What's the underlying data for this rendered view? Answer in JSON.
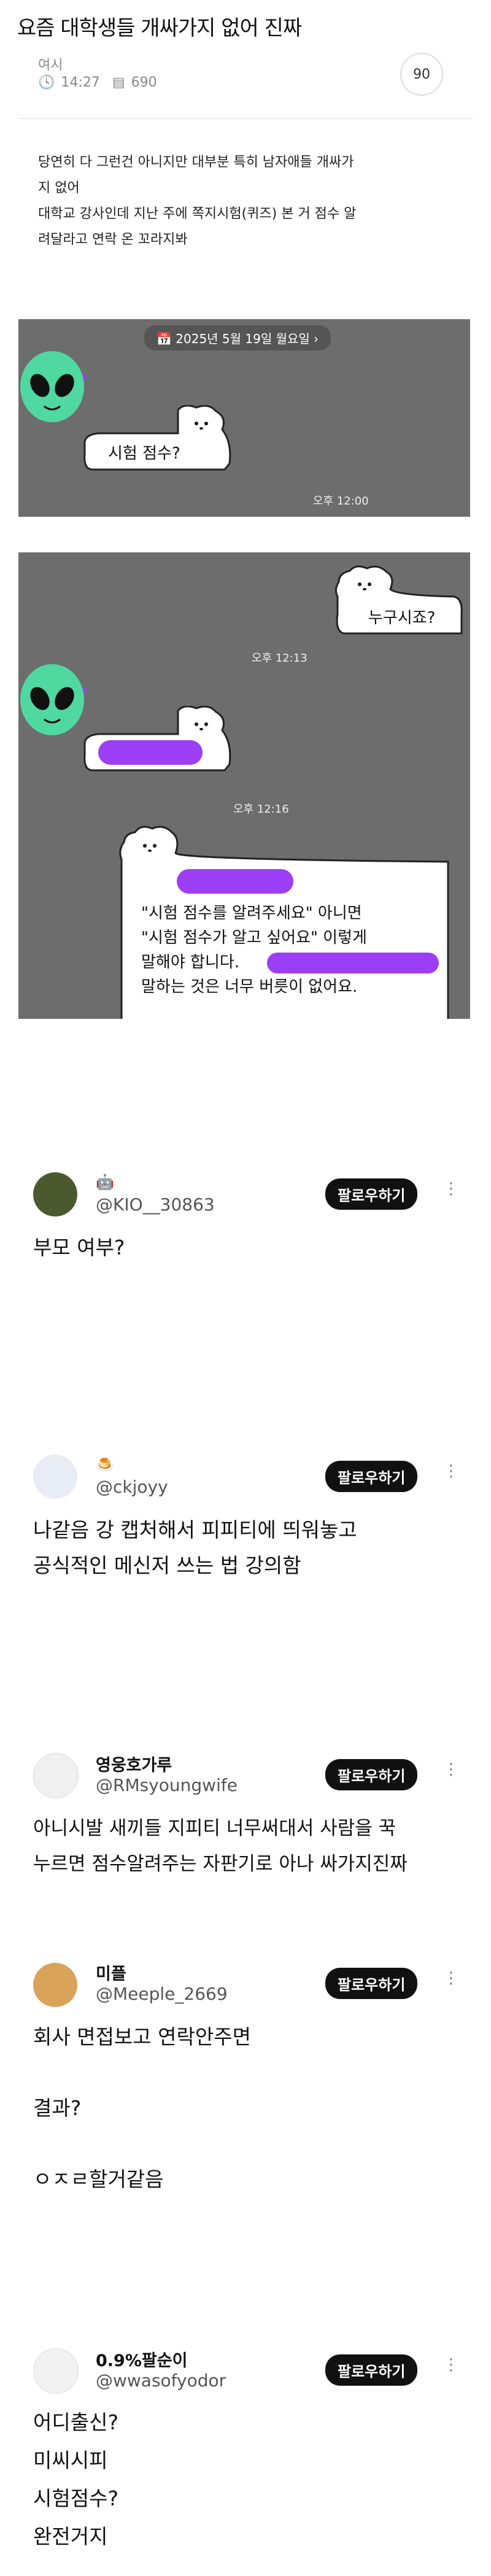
{
  "header": {
    "title": "요즘 대학생들 개싸가지 없어 진짜",
    "author": "여시",
    "time": "14:27",
    "views": "690",
    "comments": "90"
  },
  "body": {
    "line1": "당연히 다 그런건 아니지만 대부분 특히 남자애들 개싸가",
    "line2": "지 없어",
    "line3": "대학교 강사인데 지난 주에 쪽지시험(퀴즈) 본 거 점수 알",
    "line4": "려달라고 연락 온 꼬라지봐"
  },
  "chat1": {
    "date_label": "2025년 5월 19일 월요일",
    "bubble": "시험 점수?",
    "time": "오후 12:00"
  },
  "chat2": {
    "bubble1": "누구시죠?",
    "time1": "오후 12:13",
    "time2": "오후 12:16",
    "reply_line1": "\"시험 점수를 알려주세요\" 아니면",
    "reply_line2": "\"시험 점수가 알고 싶어요\" 이렇게",
    "reply_line3": "말해야 합니다.",
    "reply_line4": "말하는 것은 너무 버릇이 없어요."
  },
  "tweets": [
    {
      "name": "",
      "handle": "@KIO__30863",
      "follow": "팔로우하기",
      "lines": [
        "부모 여부?"
      ]
    },
    {
      "name": "",
      "handle": "@ckjoyy",
      "follow": "팔로우하기",
      "lines": [
        "나같음 강 캡처해서 피피티에 띄워놓고",
        "공식적인 메신저 쓰는 법 강의함"
      ]
    },
    {
      "name": "영웅호가루",
      "handle": "@RMsyoungwife",
      "follow": "팔로우하기",
      "lines": [
        "아니시발 새끼들 지피티 너무써대서 사람을 꾹",
        "누르면 점수알려주는 자판기로 아나 싸가지진짜"
      ]
    },
    {
      "name": "미플",
      "handle": "@Meeple_2669",
      "follow": "팔로우하기",
      "lines": [
        "회사 면접보고 연락안주면",
        "",
        "결과?",
        "",
        "ㅇㅈㄹ할거같음"
      ]
    },
    {
      "name": "0.9%팔순이",
      "handle": "@wwasofyodor",
      "follow": "팔로우하기",
      "lines": [
        "어디출신?",
        "미씨시피",
        "시험점수?",
        "완전거지"
      ]
    }
  ],
  "colors": {
    "chat_bg": "#6d6d6d",
    "blur": "#9b3ef5",
    "alien": "#4fd8a0",
    "follow_bg": "#111111"
  }
}
